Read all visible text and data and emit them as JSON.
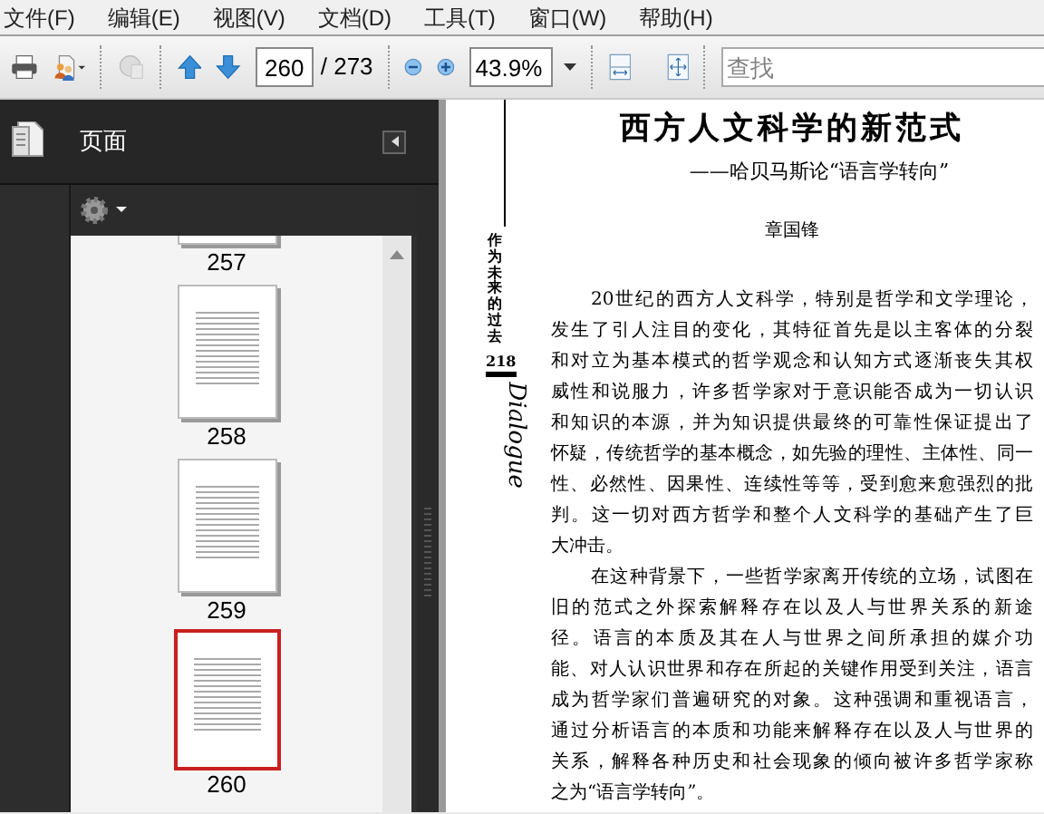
{
  "menu": [
    "文件(F)",
    "编辑(E)",
    "视图(V)",
    "文档(D)",
    "工具(T)",
    "窗口(W)",
    "帮助(H)"
  ],
  "toolbar": {
    "page_number": "260",
    "page_total": "/ 273",
    "zoom": "43.9%",
    "search_placeholder": "查找"
  },
  "nav_panel": {
    "title": "页面",
    "thumbnails": [
      {
        "label": "257",
        "selected": false
      },
      {
        "label": "258",
        "selected": false
      },
      {
        "label": "259",
        "selected": false
      },
      {
        "label": "260",
        "selected": true
      }
    ]
  },
  "document": {
    "margin_title": "作为未来的过去",
    "page_number": "218",
    "margin_logo": "Dialogue",
    "title": "西方人文科学的新范式",
    "subtitle": "——哈贝马斯论“语言学转向”",
    "author": "章国锋",
    "paragraphs": [
      [
        "20世纪的西方人文科学，特别是哲学和文学理论，",
        "发生了引人注目的变化，其特征首先是以主客体的分裂",
        "和对立为基本模式的哲学观念和认知方式逐渐丧失其权",
        "威性和说服力，许多哲学家对于意识能否成为一切认识",
        "和知识的本源，并为知识提供最终的可靠性保证提出了",
        "怀疑，传统哲学的基本概念，如先验的理性、主体性、同一",
        "性、必然性、因果性、连续性等等，受到愈来愈强烈的批",
        "判。这一切对西方哲学和整个人文科学的基础产生了巨",
        "大冲击。"
      ],
      [
        "在这种背景下，一些哲学家离开传统的立场，试图在",
        "旧的范式之外探索解释存在以及人与世界关系的新途",
        "径。语言的本质及其在人与世界之间所承担的媒介功",
        "能、对人认识世界和存在所起的关键作用受到关注，语言",
        "成为哲学家们普遍研究的对象。这种强调和重视语言，",
        "通过分析语言的本质和功能来解释存在以及人与世界的",
        "关系，解释各种历史和社会现象的倾向被许多哲学家称",
        "之为“语言学转向”。"
      ]
    ]
  }
}
